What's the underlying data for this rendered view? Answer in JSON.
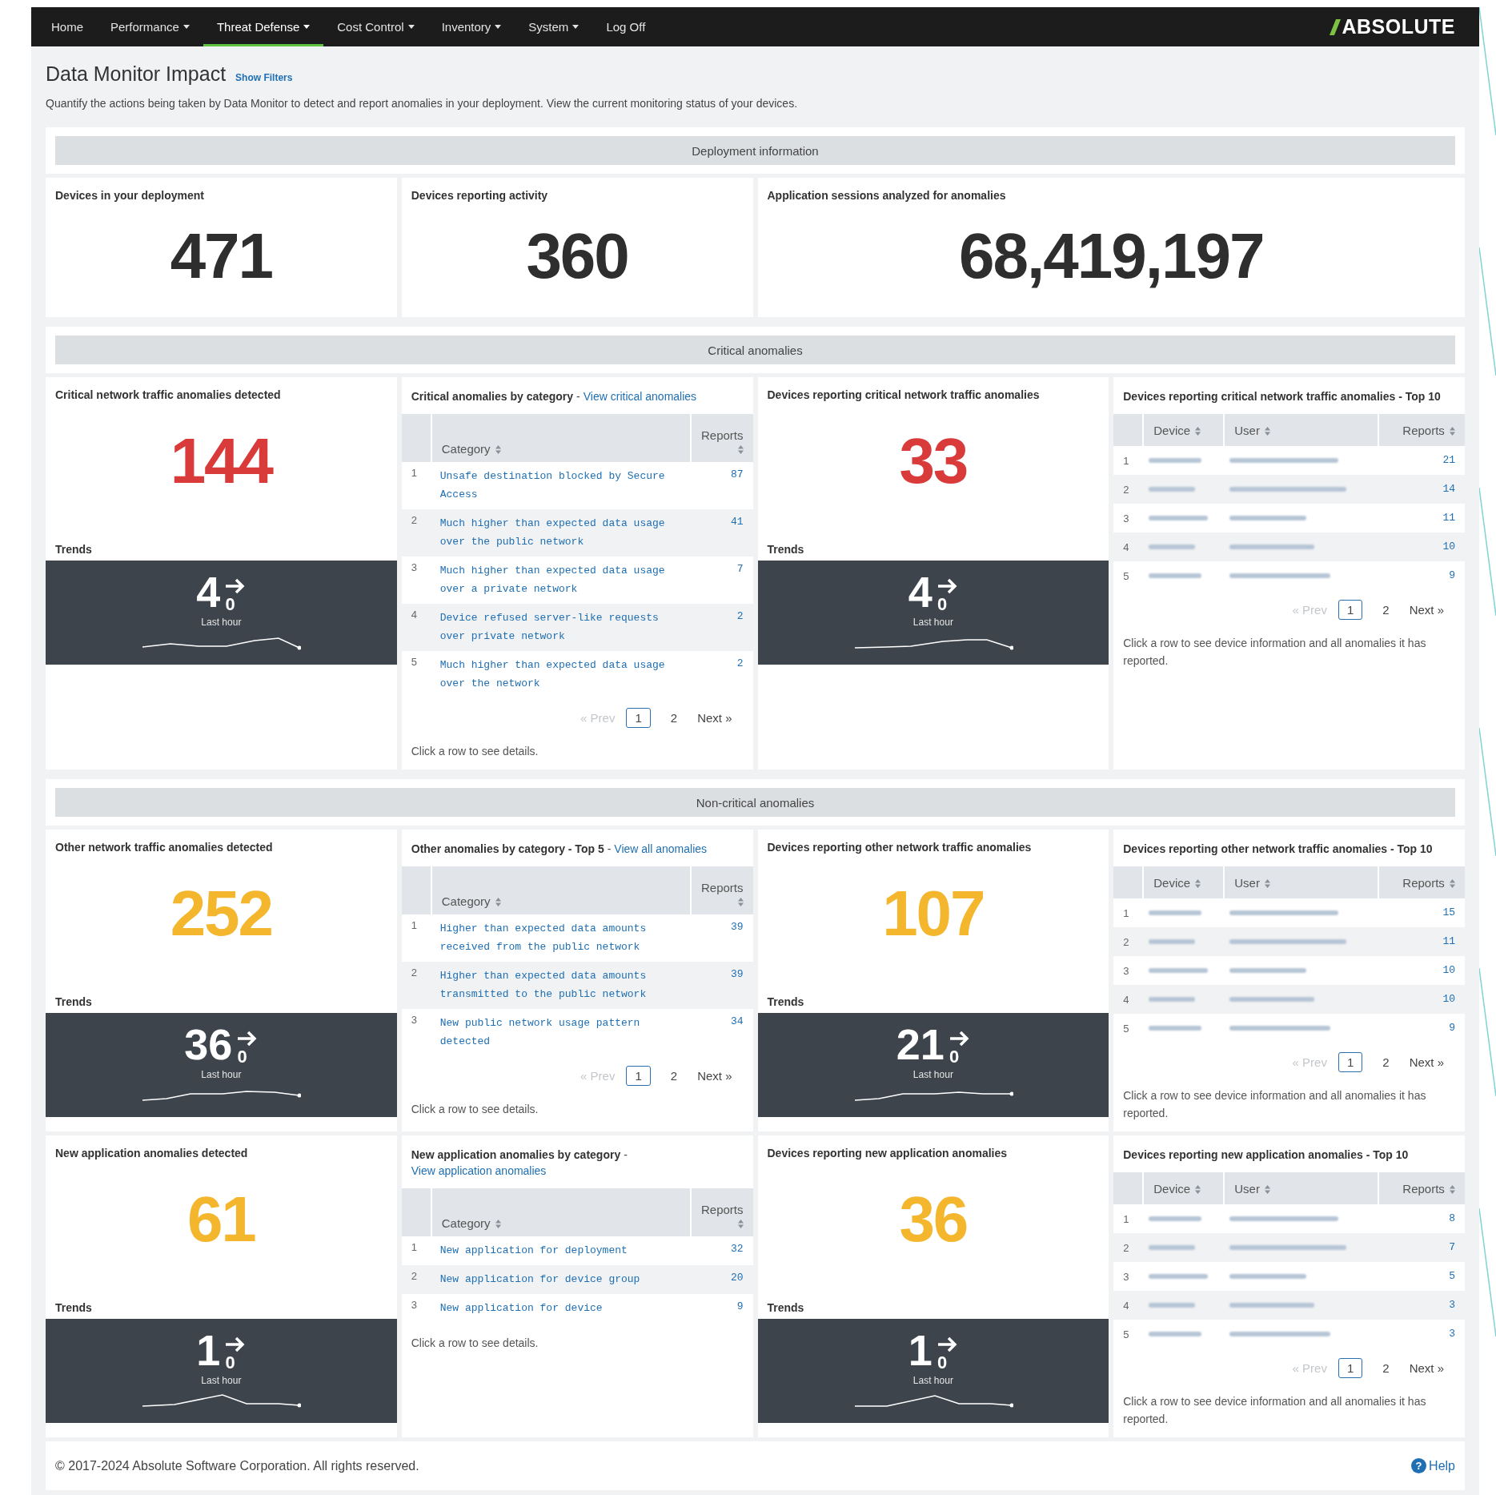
{
  "nav": {
    "items": [
      {
        "label": "Home",
        "dropdown": false,
        "selected": false
      },
      {
        "label": "Performance",
        "dropdown": true,
        "selected": false
      },
      {
        "label": "Threat Defense",
        "dropdown": true,
        "selected": true
      },
      {
        "label": "Cost Control",
        "dropdown": true,
        "selected": false
      },
      {
        "label": "Inventory",
        "dropdown": true,
        "selected": false
      },
      {
        "label": "System",
        "dropdown": true,
        "selected": false
      },
      {
        "label": "Log Off",
        "dropdown": false,
        "selected": false
      }
    ],
    "logo": "ABSOLUTE"
  },
  "page": {
    "title": "Data Monitor Impact",
    "filters_link": "Show Filters",
    "description": "Quantify the actions being taken by Data Monitor to detect and report anomalies in your deployment. View the current monitoring status of your devices."
  },
  "sections": [
    {
      "title": "Deployment information",
      "rows": [
        [
          {
            "kind": "stat",
            "wide": false,
            "title": "Devices in your deployment",
            "value": "471"
          },
          {
            "kind": "stat",
            "wide": false,
            "title": "Devices reporting activity",
            "value": "360"
          },
          {
            "kind": "stat",
            "wide": true,
            "title": "Application sessions analyzed for anomalies",
            "value": "68,419,197"
          }
        ]
      ]
    },
    {
      "title": "Critical anomalies",
      "rows": [
        [
          {
            "kind": "count",
            "title": "Critical network traffic anomalies detected",
            "value": "144",
            "color": "#d93a3a",
            "trend": {
              "label": "Trends",
              "value": "4",
              "change": "0",
              "caption": "Last hour"
            }
          },
          {
            "kind": "category_table",
            "title": "Critical anomalies by category",
            "separator": "-",
            "link": "View critical anomalies",
            "columns": [
              "Category",
              "Reports"
            ],
            "rows": [
              {
                "index": "1",
                "category": "Unsafe destination blocked by Secure Access",
                "reports": "87"
              },
              {
                "index": "2",
                "category": "Much higher than expected data usage over the public network",
                "reports": "41"
              },
              {
                "index": "3",
                "category": "Much higher than expected data usage over a private network",
                "reports": "7"
              },
              {
                "index": "4",
                "category": "Device refused server-like requests over private network",
                "reports": "2"
              },
              {
                "index": "5",
                "category": "Much higher than expected data usage over the network",
                "reports": "2"
              }
            ],
            "pager": {
              "prev": "« Prev",
              "prev_disabled": true,
              "pages": [
                {
                  "label": "1",
                  "selected": true
                },
                {
                  "label": "2",
                  "selected": false
                }
              ],
              "next": "Next »"
            },
            "note": "Click a row to see details."
          },
          {
            "kind": "count",
            "title": "Devices reporting critical network traffic anomalies",
            "value": "33",
            "color": "#d93a3a",
            "trend": {
              "label": "Trends",
              "value": "4",
              "change": "0",
              "caption": "Last hour"
            }
          },
          {
            "kind": "device_table",
            "title": "Devices reporting critical network traffic anomalies - Top 10",
            "columns": [
              "Device",
              "User",
              "Reports"
            ],
            "rows": [
              {
                "index": "1",
                "reports": "21"
              },
              {
                "index": "2",
                "reports": "14"
              },
              {
                "index": "3",
                "reports": "11"
              },
              {
                "index": "4",
                "reports": "10"
              },
              {
                "index": "5",
                "reports": "9"
              }
            ],
            "pager": {
              "prev": "« Prev",
              "prev_disabled": true,
              "pages": [
                {
                  "label": "1",
                  "selected": true
                },
                {
                  "label": "2",
                  "selected": false
                }
              ],
              "next": "Next »"
            },
            "note": "Click a row to see device information and all anomalies it has reported."
          }
        ]
      ]
    },
    {
      "title": "Non-critical anomalies",
      "rows": [
        [
          {
            "kind": "count",
            "title": "Other network traffic anomalies detected",
            "value": "252",
            "color": "#f4b62c",
            "trend": {
              "label": "Trends",
              "value": "36",
              "change": "0",
              "caption": "Last hour"
            }
          },
          {
            "kind": "category_table",
            "title": "Other anomalies by category - Top 5",
            "separator": "-",
            "link": "View all anomalies",
            "columns": [
              "Category",
              "Reports"
            ],
            "rows": [
              {
                "index": "1",
                "category": "Higher than expected data amounts received from the public network",
                "reports": "39"
              },
              {
                "index": "2",
                "category": "Higher than expected data amounts transmitted to the public network",
                "reports": "39"
              },
              {
                "index": "3",
                "category": "New public network usage pattern detected",
                "reports": "34"
              }
            ],
            "pager": {
              "prev": "« Prev",
              "prev_disabled": true,
              "pages": [
                {
                  "label": "1",
                  "selected": true
                },
                {
                  "label": "2",
                  "selected": false
                }
              ],
              "next": "Next »"
            },
            "note": "Click a row to see details."
          },
          {
            "kind": "count",
            "title": "Devices reporting other network traffic anomalies",
            "value": "107",
            "color": "#f4b62c",
            "trend": {
              "label": "Trends",
              "value": "21",
              "change": "0",
              "caption": "Last hour"
            }
          },
          {
            "kind": "device_table",
            "title": "Devices reporting other network traffic anomalies - Top 10",
            "columns": [
              "Device",
              "User",
              "Reports"
            ],
            "rows": [
              {
                "index": "1",
                "reports": "15"
              },
              {
                "index": "2",
                "reports": "11"
              },
              {
                "index": "3",
                "reports": "10"
              },
              {
                "index": "4",
                "reports": "10"
              },
              {
                "index": "5",
                "reports": "9"
              }
            ],
            "pager": {
              "prev": "« Prev",
              "prev_disabled": true,
              "pages": [
                {
                  "label": "1",
                  "selected": true
                },
                {
                  "label": "2",
                  "selected": false
                }
              ],
              "next": "Next »"
            },
            "note": "Click a row to see device information and all anomalies it has reported."
          }
        ],
        [
          {
            "kind": "count",
            "title": "New application anomalies detected",
            "value": "61",
            "color": "#f4b62c",
            "trend": {
              "label": "Trends",
              "value": "1",
              "change": "0",
              "caption": "Last hour"
            }
          },
          {
            "kind": "category_table",
            "title": "New application anomalies by category",
            "separator": "-",
            "link": "View application anomalies",
            "columns": [
              "Category",
              "Reports"
            ],
            "rows": [
              {
                "index": "1",
                "category": "New application for deployment",
                "reports": "32"
              },
              {
                "index": "2",
                "category": "New application for device group",
                "reports": "20"
              },
              {
                "index": "3",
                "category": "New application for device",
                "reports": "9"
              }
            ],
            "note": "Click a row to see details."
          },
          {
            "kind": "count",
            "title": "Devices reporting new application anomalies",
            "value": "36",
            "color": "#f4b62c",
            "trend": {
              "label": "Trends",
              "value": "1",
              "change": "0",
              "caption": "Last hour"
            }
          },
          {
            "kind": "device_table",
            "title": "Devices reporting new application anomalies - Top 10",
            "columns": [
              "Device",
              "User",
              "Reports"
            ],
            "rows": [
              {
                "index": "1",
                "reports": "8"
              },
              {
                "index": "2",
                "reports": "7"
              },
              {
                "index": "3",
                "reports": "5"
              },
              {
                "index": "4",
                "reports": "3"
              },
              {
                "index": "5",
                "reports": "3"
              }
            ],
            "pager": {
              "prev": "« Prev",
              "prev_disabled": true,
              "pages": [
                {
                  "label": "1",
                  "selected": true
                },
                {
                  "label": "2",
                  "selected": false
                }
              ],
              "next": "Next »"
            },
            "note": "Click a row to see device information and all anomalies it has reported."
          }
        ]
      ]
    }
  ],
  "footer": {
    "copyright": "© 2017-2024 Absolute Software Corporation. All rights reserved.",
    "help_icon": "?",
    "help": "Help"
  }
}
